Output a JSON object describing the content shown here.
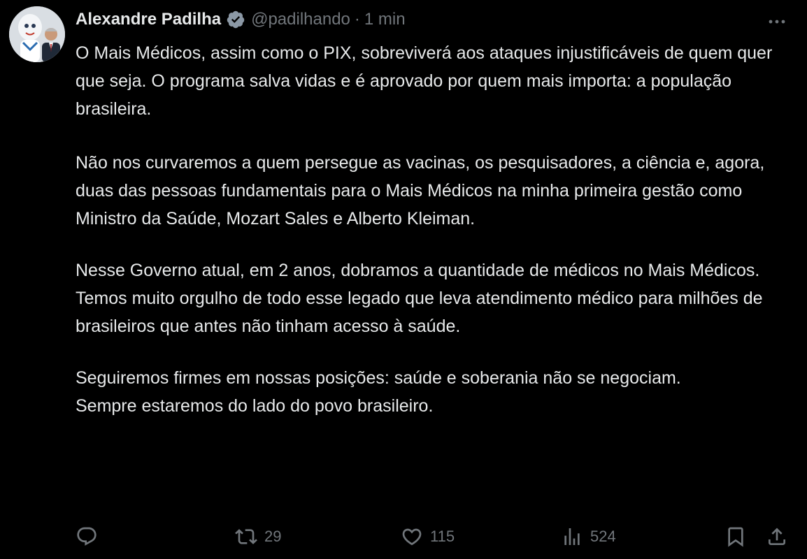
{
  "author": {
    "name": "Alexandre Padilha",
    "handle": "@padilhando",
    "separator": "·",
    "time": "1 min",
    "verified": true,
    "verified_color": "#8b98a5"
  },
  "tweet": {
    "paragraphs": [
      "O Mais Médicos, assim como o PIX, sobreviverá aos ataques injustificáveis de quem quer que seja. O programa salva vidas e é aprovado por quem mais importa: a população brasileira.",
      "Não nos curvaremos a quem persegue as vacinas, os pesquisadores, a ciência e, agora, duas das pessoas fundamentais para o Mais Médicos na minha primeira gestão como Ministro da Saúde, Mozart Sales e Alberto Kleiman.",
      "Nesse Governo atual, em 2 anos, dobramos a quantidade de médicos no Mais Médicos. Temos muito orgulho de todo esse legado que leva atendimento médico para milhões de brasileiros que antes não tinham acesso à saúde.",
      "Seguiremos firmes em nossas posições: saúde e soberania não se negociam.",
      "Sempre estaremos do lado do povo brasileiro."
    ]
  },
  "actions": {
    "reply_icon": "reply-icon",
    "retweet_icon": "retweet-icon",
    "retweets": "29",
    "like_icon": "heart-icon",
    "likes": "115",
    "views_icon": "bar-chart-icon",
    "views": "524",
    "bookmark_icon": "bookmark-icon",
    "share_icon": "share-icon"
  },
  "colors": {
    "background": "#000000",
    "text": "#e7e9ea",
    "muted": "#71767b"
  }
}
